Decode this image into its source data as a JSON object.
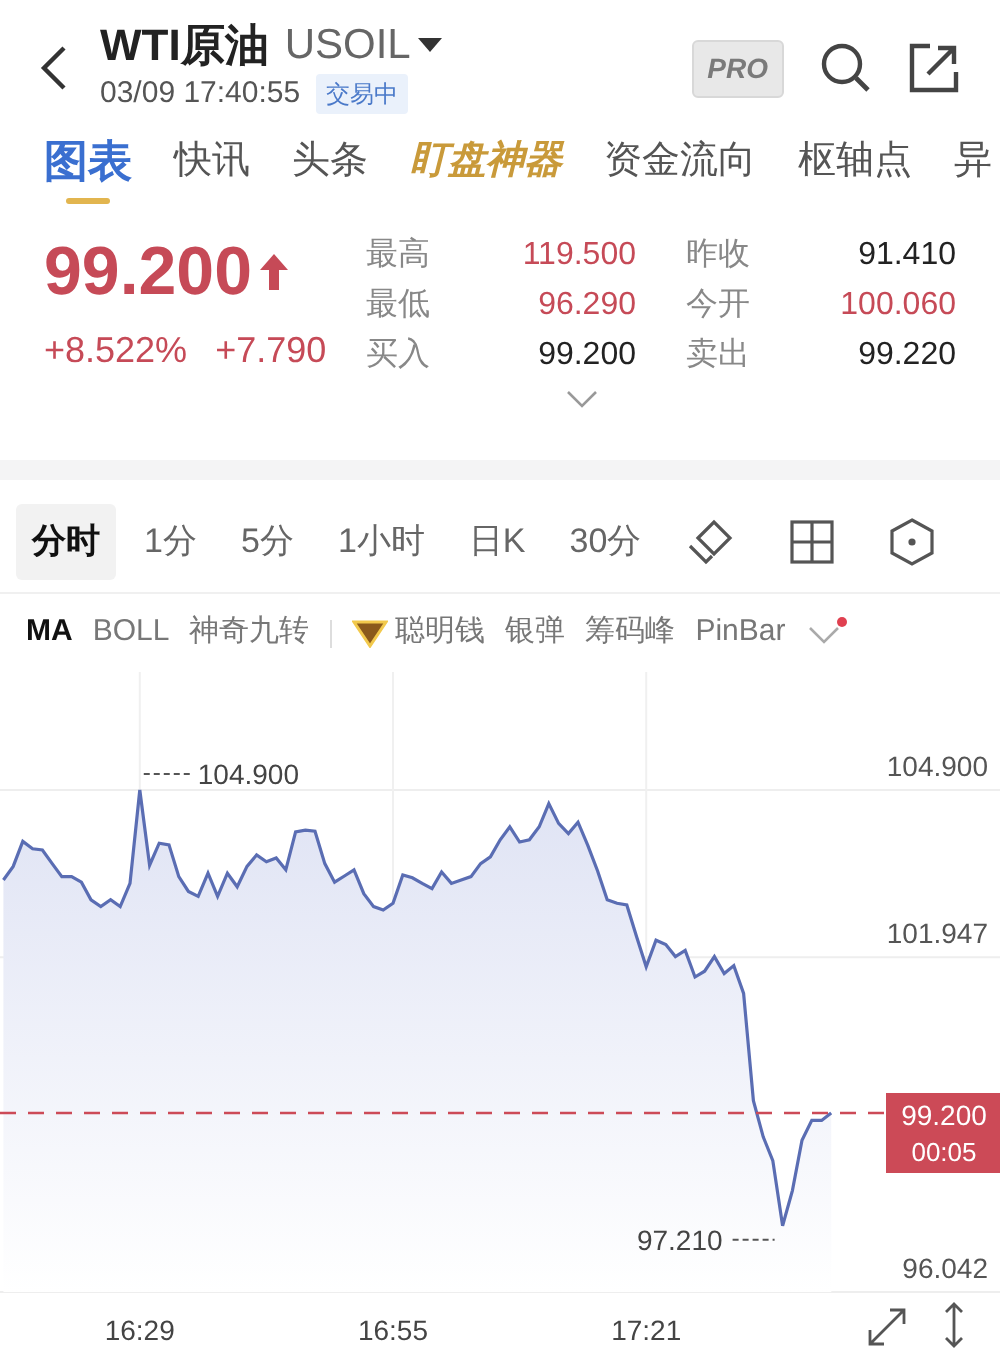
{
  "header": {
    "title": "WTI原油",
    "symbol": "USOIL",
    "datetime": "03/09 17:40:55",
    "status_badge": "交易中",
    "pro_badge": "PRO"
  },
  "tabs": [
    {
      "label": "图表",
      "selected": true,
      "kind": "normal"
    },
    {
      "label": "快讯",
      "selected": false,
      "kind": "normal"
    },
    {
      "label": "头条",
      "selected": false,
      "kind": "normal"
    },
    {
      "label": "盯盘神器",
      "selected": false,
      "kind": "featured"
    },
    {
      "label": "资金流向",
      "selected": false,
      "kind": "normal"
    },
    {
      "label": "枢轴点",
      "selected": false,
      "kind": "normal"
    },
    {
      "label": "异",
      "selected": false,
      "kind": "normal"
    }
  ],
  "quote": {
    "price": "99.200",
    "rising": true,
    "change_pct": "+8.522%",
    "change": "+7.790",
    "stats": [
      {
        "label": "最高",
        "value": "119.500",
        "rising": true
      },
      {
        "label": "昨收",
        "value": "91.410",
        "rising": false
      },
      {
        "label": "最低",
        "value": "96.290",
        "rising": true
      },
      {
        "label": "今开",
        "value": "100.060",
        "rising": true
      },
      {
        "label": "买入",
        "value": "99.200",
        "rising": false
      },
      {
        "label": "卖出",
        "value": "99.220",
        "rising": false
      }
    ]
  },
  "period_tabs": [
    {
      "label": "分时",
      "selected": true
    },
    {
      "label": "1分",
      "selected": false
    },
    {
      "label": "5分",
      "selected": false
    },
    {
      "label": "1小时",
      "selected": false
    },
    {
      "label": "日K",
      "selected": false
    },
    {
      "label": "30分",
      "selected": false
    }
  ],
  "indicators": [
    {
      "label": "MA",
      "selected": true,
      "kind": "plain"
    },
    {
      "label": "BOLL",
      "selected": false,
      "kind": "plain"
    },
    {
      "label": "神奇九转",
      "selected": false,
      "kind": "plain"
    },
    {
      "label": "聪明钱",
      "selected": false,
      "kind": "premium"
    },
    {
      "label": "银弹",
      "selected": false,
      "kind": "plain"
    },
    {
      "label": "筹码峰",
      "selected": false,
      "kind": "plain"
    },
    {
      "label": "PinBar",
      "selected": false,
      "kind": "plain"
    }
  ],
  "indicators_more_notification": true,
  "chart": {
    "price_tag": {
      "price": "99.200",
      "countdown": "00:05"
    },
    "chart_data": {
      "type": "area",
      "categories": [
        null,
        null,
        null,
        null,
        null,
        null,
        null,
        null,
        null,
        null,
        null,
        null,
        null,
        null,
        "16:29",
        null,
        null,
        null,
        null,
        null,
        null,
        null,
        null,
        null,
        null,
        null,
        null,
        null,
        null,
        null,
        null,
        null,
        null,
        null,
        null,
        null,
        null,
        null,
        null,
        null,
        "16:55",
        null,
        null,
        null,
        null,
        null,
        null,
        null,
        null,
        null,
        null,
        null,
        null,
        null,
        null,
        null,
        null,
        null,
        null,
        null,
        null,
        null,
        null,
        null,
        null,
        null,
        "17:21",
        null,
        null,
        null,
        null,
        null,
        null,
        null,
        null,
        null,
        null,
        null,
        null,
        null,
        null,
        null,
        null,
        null,
        null,
        null
      ],
      "series": [
        {
          "color": "#5a6db3",
          "values": [
            103.31,
            103.55,
            103.99,
            103.86,
            103.84,
            103.6,
            103.37,
            103.37,
            103.27,
            102.96,
            102.84,
            102.96,
            102.84,
            103.25,
            104.9,
            103.57,
            103.96,
            103.93,
            103.37,
            103.11,
            103.02,
            103.43,
            103.02,
            103.43,
            103.19,
            103.55,
            103.75,
            103.63,
            103.7,
            103.49,
            104.16,
            104.19,
            104.17,
            103.6,
            103.27,
            103.38,
            103.49,
            103.07,
            102.84,
            102.78,
            102.9,
            103.4,
            103.35,
            103.25,
            103.16,
            103.45,
            103.25,
            103.31,
            103.37,
            103.6,
            103.72,
            104.02,
            104.25,
            103.98,
            104.02,
            104.25,
            104.66,
            104.31,
            104.13,
            104.33,
            103.92,
            103.47,
            102.96,
            102.9,
            102.87,
            102.31,
            101.78,
            102.25,
            102.17,
            101.96,
            102.07,
            101.6,
            101.7,
            101.96,
            101.66,
            101.8,
            101.31,
            99.42,
            98.78,
            98.36,
            97.21,
            97.83,
            98.72,
            99.07,
            99.07,
            99.2
          ]
        }
      ],
      "ylim": [
        96.042,
        106.98
      ],
      "yticks": [
        {
          "value": 104.9,
          "label": "104.900"
        },
        {
          "value": 101.947,
          "label": "101.947"
        },
        {
          "value": 96.042,
          "label": "96.042"
        }
      ],
      "grid": true,
      "ref_lines": [
        {
          "axis": "y",
          "value": 99.2,
          "color": "#cc4a57"
        }
      ],
      "annotations": [
        "104.900",
        "97.210"
      ]
    }
  }
}
